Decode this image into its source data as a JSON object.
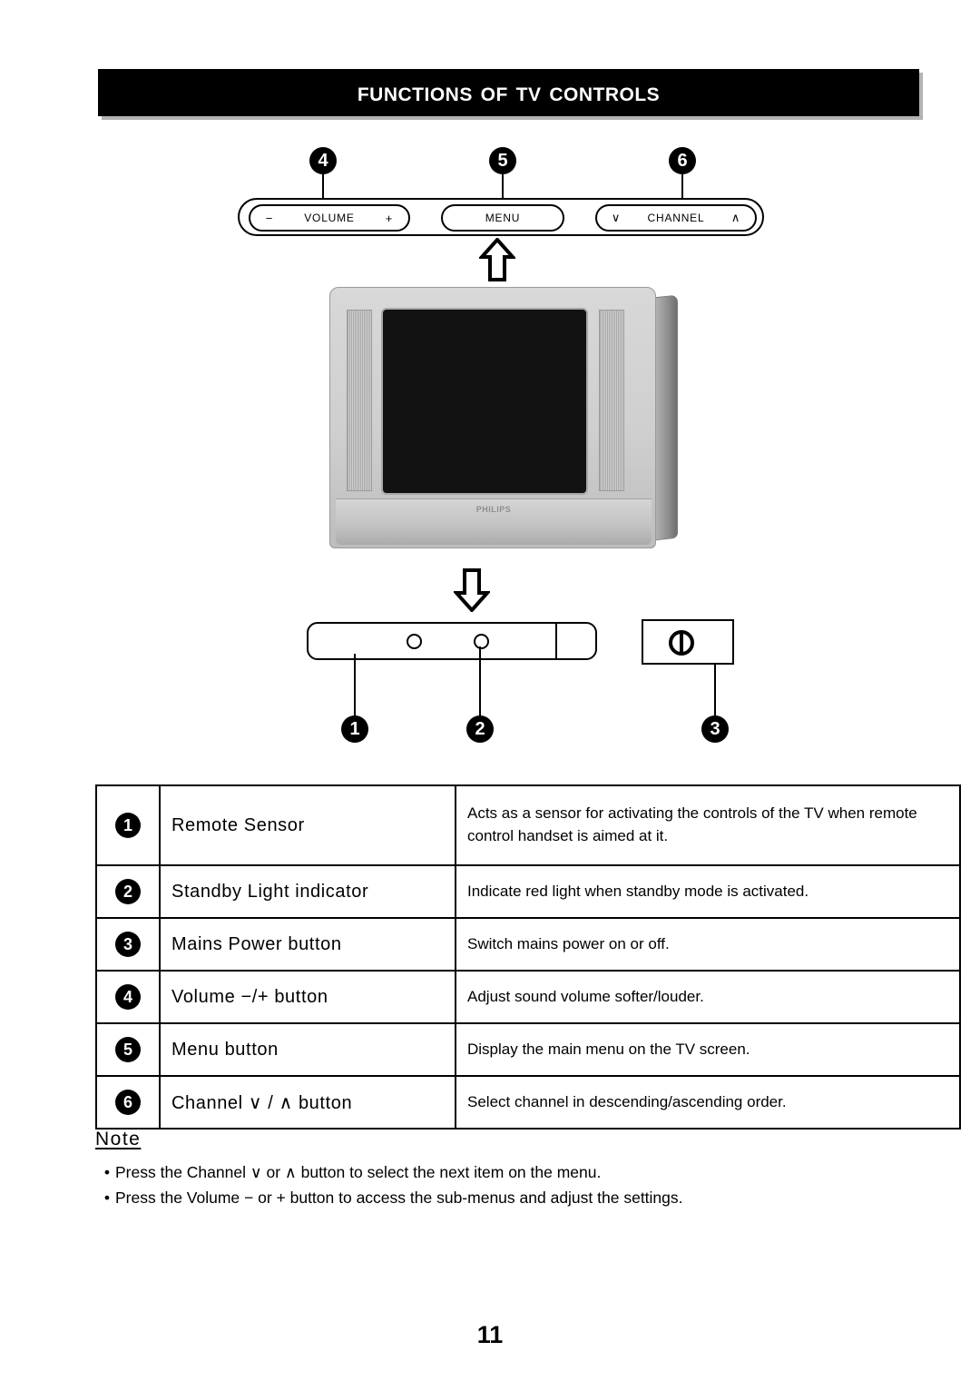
{
  "header": {
    "title": "Functions Of TV Controls"
  },
  "diagram": {
    "controls_strip": {
      "volume_button": {
        "minus": "−",
        "label": "VOLUME",
        "plus": "+"
      },
      "menu_button": {
        "label": "MENU"
      },
      "channel_button": {
        "down": "∨",
        "label": "CHANNEL",
        "up": "∧"
      }
    },
    "callouts": [
      {
        "number": "1"
      },
      {
        "number": "2"
      },
      {
        "number": "3"
      },
      {
        "number": "4"
      },
      {
        "number": "5"
      },
      {
        "number": "6"
      }
    ],
    "tv": {
      "brand_logo": "PHILIPS"
    },
    "power_symbol_name": "power-symbol"
  },
  "table": {
    "rows": [
      {
        "number": "1",
        "name": "Remote Sensor",
        "description": "Acts as a sensor for activating the controls of the TV when remote control handset is aimed at it."
      },
      {
        "number": "2",
        "name": "Standby Light indicator",
        "description": "Indicate red light when standby mode is activated."
      },
      {
        "number": "3",
        "name": "Mains Power button",
        "description": "Switch mains power on or off."
      },
      {
        "number": "4",
        "name": "Volume −/+ button",
        "description": "Adjust sound volume softer/louder."
      },
      {
        "number": "5",
        "name": "Menu button",
        "description": "Display the main menu on the TV screen."
      },
      {
        "number": "6",
        "name": "Channel ∨ / ∧ button",
        "description": "Select channel in descending/ascending order."
      }
    ]
  },
  "note": {
    "heading": "Note",
    "bullet": "•",
    "items": [
      "Press the Channel ∨ or ∧ button to select the next item on the menu.",
      "Press the Volume − or + button to access the sub-menus and adjust the settings."
    ]
  },
  "footer": {
    "page_number": "11"
  }
}
